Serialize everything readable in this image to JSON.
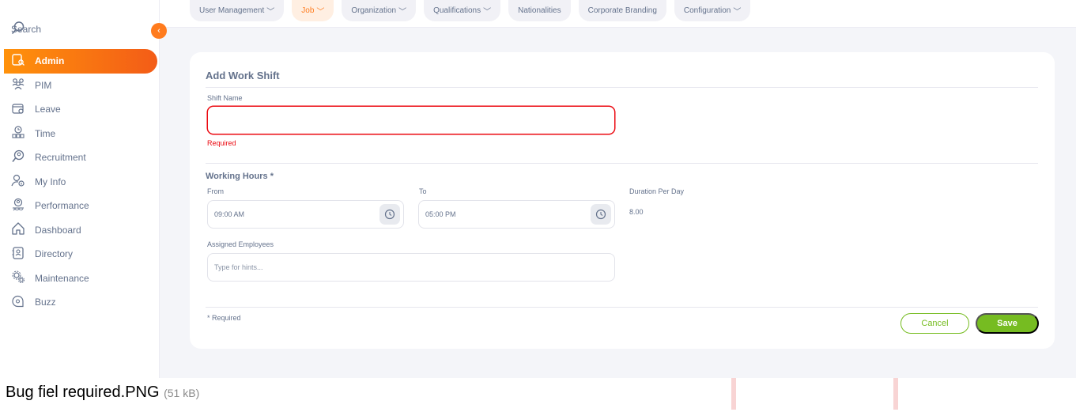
{
  "sidebar": {
    "search_label": "Search",
    "items": [
      {
        "label": "Admin",
        "icon": "admin-icon",
        "active": true
      },
      {
        "label": "PIM",
        "icon": "pim-icon"
      },
      {
        "label": "Leave",
        "icon": "leave-icon"
      },
      {
        "label": "Time",
        "icon": "time-icon"
      },
      {
        "label": "Recruitment",
        "icon": "recruitment-icon"
      },
      {
        "label": "My Info",
        "icon": "my-info-icon"
      },
      {
        "label": "Performance",
        "icon": "performance-icon"
      },
      {
        "label": "Dashboard",
        "icon": "dashboard-icon"
      },
      {
        "label": "Directory",
        "icon": "directory-icon"
      },
      {
        "label": "Maintenance",
        "icon": "maintenance-icon"
      },
      {
        "label": "Buzz",
        "icon": "buzz-icon"
      }
    ]
  },
  "topbar": {
    "tabs": [
      {
        "label": "User Management",
        "dropdown": true
      },
      {
        "label": "Job",
        "dropdown": true,
        "active": true
      },
      {
        "label": "Organization",
        "dropdown": true
      },
      {
        "label": "Qualifications",
        "dropdown": true
      },
      {
        "label": "Nationalities",
        "dropdown": false
      },
      {
        "label": "Corporate Branding",
        "dropdown": false
      },
      {
        "label": "Configuration",
        "dropdown": true
      }
    ]
  },
  "form": {
    "title": "Add Work Shift",
    "shift_name_label": "Shift Name",
    "shift_name_value": "",
    "shift_name_error": "Required",
    "working_hours_title": "Working Hours *",
    "from_label": "From",
    "from_value": "09:00 AM",
    "to_label": "To",
    "to_value": "05:00 PM",
    "duration_label": "Duration Per Day",
    "duration_value": "8.00",
    "assigned_label": "Assigned Employees",
    "assigned_placeholder": "Type for hints...",
    "required_note": "* Required",
    "cancel_label": "Cancel",
    "save_label": "Save"
  },
  "footer": {
    "filename": "Bug fiel required.PNG",
    "filesize": "(51 kB)"
  },
  "colors": {
    "accent": "#ff7b1d",
    "success": "#76bc21",
    "error": "#eb0910"
  }
}
